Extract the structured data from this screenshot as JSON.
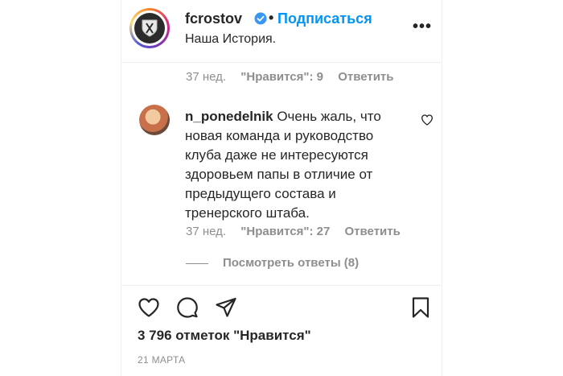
{
  "post": {
    "username": "fcrostov",
    "follow_label": "Подписаться",
    "caption": "Наша История.",
    "separator": "•"
  },
  "comment_prev": {
    "age": "37 нед.",
    "likes": "\"Нравится\": 9",
    "reply": "Ответить"
  },
  "comment": {
    "username": "n_ponedelnik",
    "text": "Очень жаль, что новая команда и руководство клуба даже не интересуются здоровьем папы в отличие от предыдущего состава и тренерского штаба.",
    "age": "37 нед.",
    "likes": "\"Нравится\": 27",
    "reply": "Ответить",
    "view_replies": "Посмотреть ответы (8)"
  },
  "footer": {
    "likes_count": "3 796 отметок \"Нравится\"",
    "date": "21 МАРТА"
  },
  "icons": {
    "verified": "verified-badge-icon",
    "more": "more-options-icon",
    "heart": "heart-icon",
    "comment": "comment-icon",
    "share": "share-icon",
    "save": "bookmark-icon"
  },
  "colors": {
    "accent": "#0095f6",
    "text": "#262626",
    "muted": "#8e8e8e"
  }
}
